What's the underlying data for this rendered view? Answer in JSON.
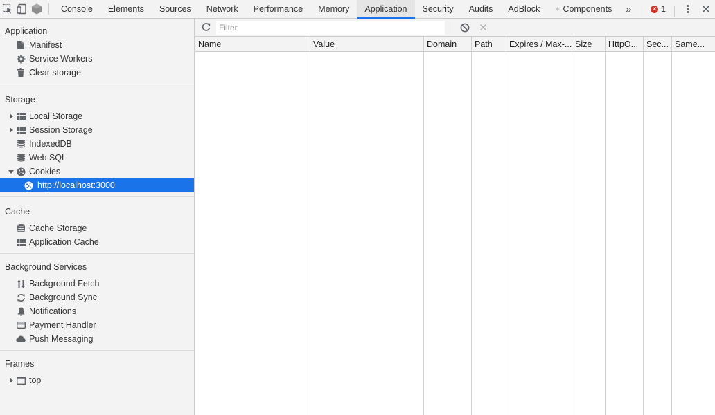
{
  "toolbar": {
    "tabs": [
      {
        "label": "Console"
      },
      {
        "label": "Elements"
      },
      {
        "label": "Sources"
      },
      {
        "label": "Network"
      },
      {
        "label": "Performance"
      },
      {
        "label": "Memory"
      },
      {
        "label": "Application",
        "selected": true
      },
      {
        "label": "Security"
      },
      {
        "label": "Audits"
      },
      {
        "label": "AdBlock"
      },
      {
        "label": "Components"
      }
    ],
    "more_tabs": "»",
    "error_count": "1",
    "accent_color": "#1a73e8",
    "error_color": "#d93025"
  },
  "sidebar": {
    "application": {
      "title": "Application",
      "items": [
        {
          "label": "Manifest",
          "icon": "document-icon"
        },
        {
          "label": "Service Workers",
          "icon": "gear-icon"
        },
        {
          "label": "Clear storage",
          "icon": "trash-icon"
        }
      ]
    },
    "storage": {
      "title": "Storage",
      "items": [
        {
          "label": "Local Storage",
          "icon": "table-icon"
        },
        {
          "label": "Session Storage",
          "icon": "table-icon"
        },
        {
          "label": "IndexedDB",
          "icon": "database-icon"
        },
        {
          "label": "Web SQL",
          "icon": "database-icon"
        },
        {
          "label": "Cookies",
          "icon": "cookie-icon"
        }
      ],
      "cookie_child": "http://localhost:3000"
    },
    "cache": {
      "title": "Cache",
      "items": [
        {
          "label": "Cache Storage",
          "icon": "database-icon"
        },
        {
          "label": "Application Cache",
          "icon": "table-icon"
        }
      ]
    },
    "background": {
      "title": "Background Services",
      "items": [
        {
          "label": "Background Fetch",
          "icon": "updown-arrows-icon"
        },
        {
          "label": "Background Sync",
          "icon": "sync-icon"
        },
        {
          "label": "Notifications",
          "icon": "bell-icon"
        },
        {
          "label": "Payment Handler",
          "icon": "card-icon"
        },
        {
          "label": "Push Messaging",
          "icon": "cloud-icon"
        }
      ]
    },
    "frames": {
      "title": "Frames",
      "items": [
        {
          "label": "top",
          "icon": "frame-icon"
        }
      ]
    }
  },
  "main": {
    "filter": {
      "placeholder": "Filter",
      "value": ""
    },
    "columns": [
      "Name",
      "Value",
      "Domain",
      "Path",
      "Expires / Max-...",
      "Size",
      "HttpO...",
      "Sec...",
      "Same..."
    ],
    "rows": []
  }
}
